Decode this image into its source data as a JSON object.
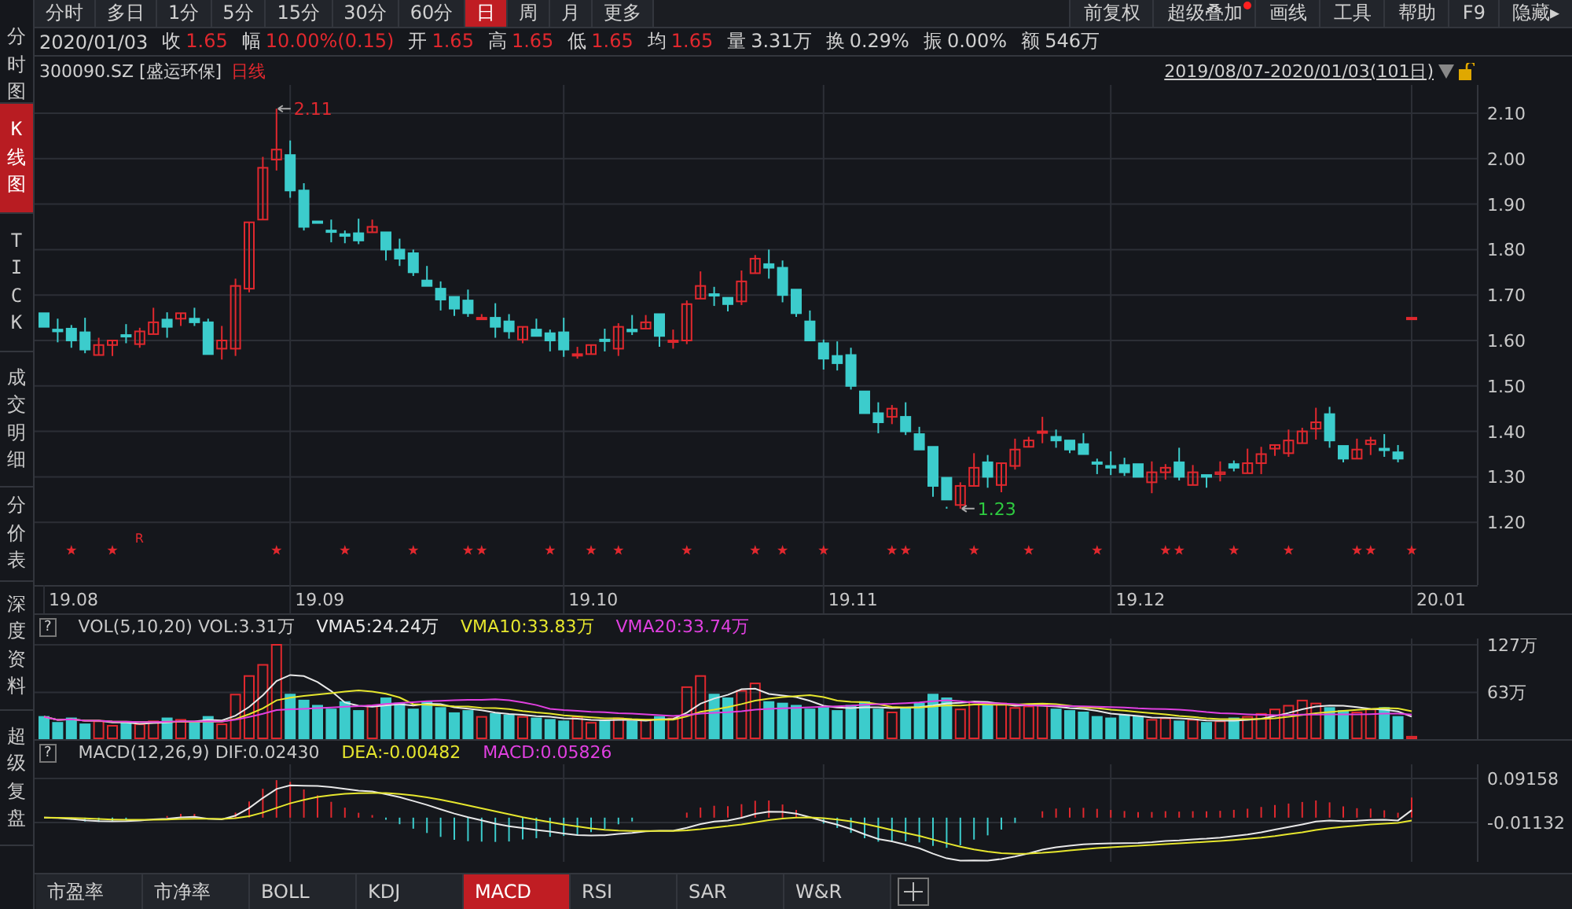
{
  "period_tabs": [
    {
      "label": "分时",
      "selected": false
    },
    {
      "label": "多日",
      "selected": false
    },
    {
      "label": "1分",
      "selected": false
    },
    {
      "label": "5分",
      "selected": false
    },
    {
      "label": "15分",
      "selected": false
    },
    {
      "label": "30分",
      "selected": false
    },
    {
      "label": "60分",
      "selected": false
    },
    {
      "label": "日",
      "selected": true
    },
    {
      "label": "周",
      "selected": false
    },
    {
      "label": "月",
      "selected": false
    },
    {
      "label": "更多",
      "selected": false
    }
  ],
  "tool_buttons": [
    {
      "label": "前复权",
      "badge": false
    },
    {
      "label": "超级叠加",
      "badge": true
    },
    {
      "label": "画线",
      "badge": false
    },
    {
      "label": "工具",
      "badge": false
    },
    {
      "label": "帮助",
      "badge": false
    },
    {
      "label": "F9",
      "badge": false
    },
    {
      "label": "隐藏▸",
      "badge": false
    }
  ],
  "sidebar": [
    {
      "label": "分时图",
      "selected": false
    },
    {
      "label": "K线图",
      "selected": true
    },
    {
      "label": "TICK",
      "selected": false
    },
    {
      "label": "成交明细",
      "selected": false
    },
    {
      "label": "分价表",
      "selected": false
    },
    {
      "label": "深度资料",
      "selected": false
    },
    {
      "label": "超级复盘",
      "selected": false
    }
  ],
  "quote": {
    "date": "2020/01/03",
    "items": [
      {
        "label": "收",
        "value": "1.65",
        "kind": "rise"
      },
      {
        "label": "幅",
        "value": "10.00%(0.15)",
        "kind": "rise"
      },
      {
        "label": "开",
        "value": "1.65",
        "kind": "rise"
      },
      {
        "label": "高",
        "value": "1.65",
        "kind": "rise"
      },
      {
        "label": "低",
        "value": "1.65",
        "kind": "rise"
      },
      {
        "label": "均",
        "value": "1.65",
        "kind": "rise"
      },
      {
        "label": "量",
        "value": "3.31万",
        "kind": "plain"
      },
      {
        "label": "换",
        "value": "0.29%",
        "kind": "plain"
      },
      {
        "label": "振",
        "value": "0.00%",
        "kind": "plain"
      },
      {
        "label": "额",
        "value": "546万",
        "kind": "plain"
      }
    ]
  },
  "kline": {
    "stock": "300090.SZ [盛运环保]",
    "period": "日线",
    "range": "2019/08/07-2020/01/03(101日)",
    "price_ticks": [
      "2.10",
      "2.00",
      "1.90",
      "1.80",
      "1.70",
      "1.60",
      "1.50",
      "1.40",
      "1.30",
      "1.20"
    ],
    "annotations": [
      {
        "kind": "high",
        "text": "2.11"
      },
      {
        "kind": "low",
        "text": "1.23"
      }
    ],
    "event_marks": [
      {
        "kind": "star"
      },
      {
        "kind": "star"
      },
      {
        "kind": "label",
        "text": "R"
      },
      {
        "kind": "star"
      },
      {
        "kind": "star"
      },
      {
        "kind": "star"
      },
      {
        "kind": "star"
      },
      {
        "kind": "star"
      },
      {
        "kind": "star"
      },
      {
        "kind": "star"
      },
      {
        "kind": "star"
      },
      {
        "kind": "star"
      },
      {
        "kind": "star"
      },
      {
        "kind": "star"
      },
      {
        "kind": "star"
      },
      {
        "kind": "star"
      },
      {
        "kind": "star"
      },
      {
        "kind": "star"
      },
      {
        "kind": "star"
      },
      {
        "kind": "star"
      },
      {
        "kind": "star"
      },
      {
        "kind": "star"
      },
      {
        "kind": "star"
      },
      {
        "kind": "star"
      },
      {
        "kind": "star"
      },
      {
        "kind": "star"
      },
      {
        "kind": "star"
      }
    ],
    "date_labels": [
      "19.08",
      "19.09",
      "19.10",
      "19.11",
      "19.12",
      "20.01"
    ]
  },
  "volume": {
    "help": "?",
    "legend": [
      {
        "text": "VOL(5,10,20) VOL:3.31万",
        "color": "#c8c8c8"
      },
      {
        "text": "VMA5:24.24万",
        "color": "#e8e8e8"
      },
      {
        "text": "VMA10:33.83万",
        "color": "#e6e62e"
      },
      {
        "text": "VMA20:33.74万",
        "color": "#e040e0"
      }
    ],
    "ticks": [
      "127万",
      "63万"
    ]
  },
  "macd": {
    "help": "?",
    "legend": [
      {
        "text": "MACD(12,26,9) DIF:0.02430",
        "color": "#c8c8c8"
      },
      {
        "text": "DEA:-0.00482",
        "color": "#e6e62e"
      },
      {
        "text": "MACD:0.05826",
        "color": "#e040e0"
      }
    ],
    "ticks": [
      "0.09158",
      "-0.01132"
    ]
  },
  "indicator_tabs": [
    {
      "label": "市盈率",
      "selected": false
    },
    {
      "label": "市净率",
      "selected": false
    },
    {
      "label": "BOLL",
      "selected": false
    },
    {
      "label": "KDJ",
      "selected": false
    },
    {
      "label": "MACD",
      "selected": true
    },
    {
      "label": "RSI",
      "selected": false
    },
    {
      "label": "SAR",
      "selected": false
    },
    {
      "label": "W&R",
      "selected": false
    }
  ]
}
